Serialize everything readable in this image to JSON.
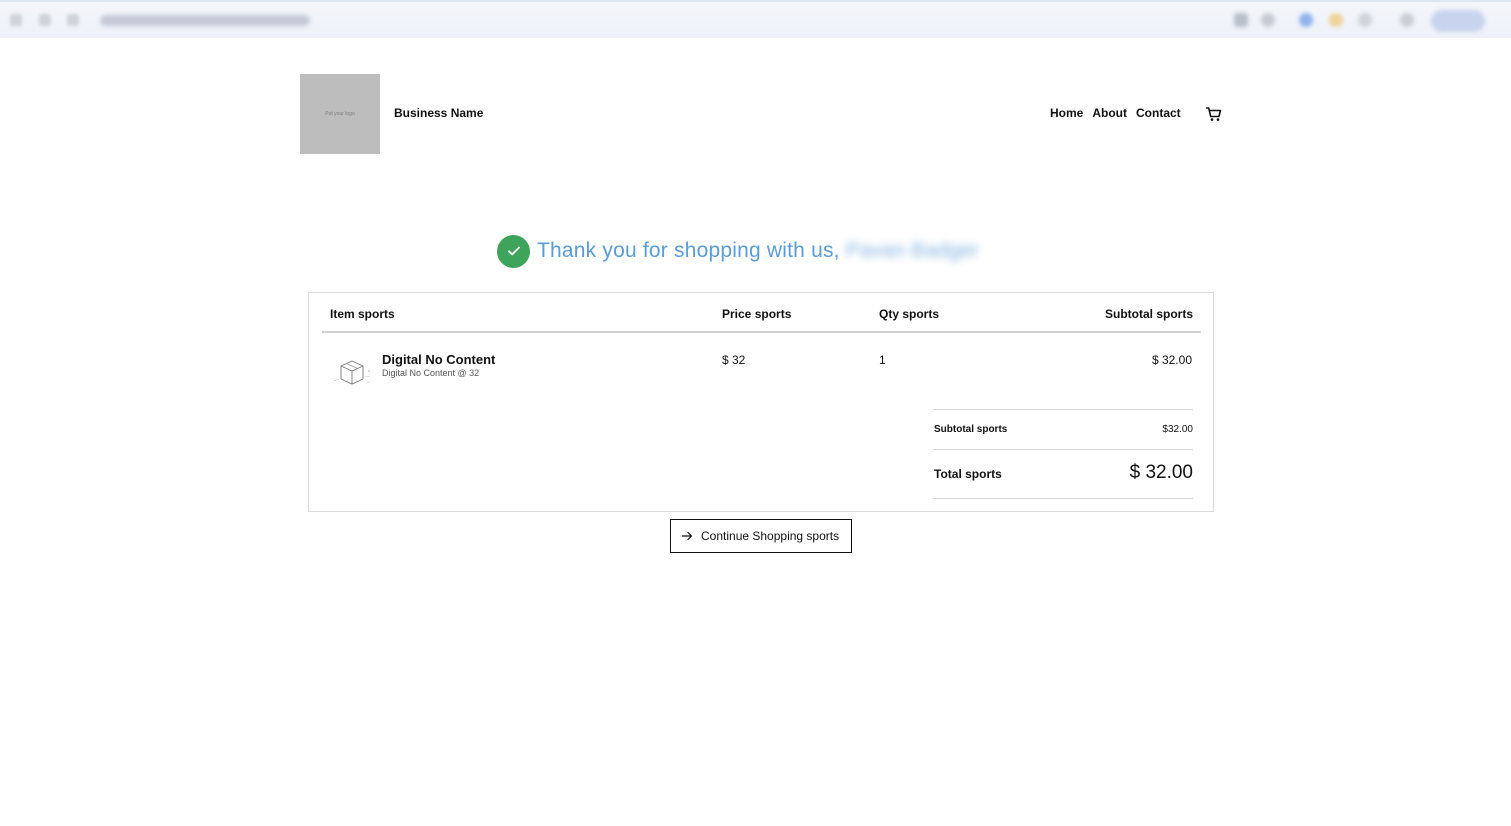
{
  "header": {
    "logo_placeholder": "Put your logo",
    "business_name": "Business Name",
    "nav": [
      "Home",
      "About",
      "Contact"
    ]
  },
  "confirmation": {
    "message": "Thank you for shopping with us,",
    "customer_name": "Pavan Badger"
  },
  "order_table": {
    "columns": [
      "Item sports",
      "Price sports",
      "Qty sports",
      "Subtotal sports"
    ],
    "items": [
      {
        "name": "Digital No Content",
        "detail": "Digital No Content @ 32",
        "price": "$ 32",
        "qty": "1",
        "subtotal": "$ 32.00"
      }
    ],
    "subtotal_label": "Subtotal sports",
    "subtotal_value": "$32.00",
    "total_label": "Total sports",
    "total_value": "$ 32.00"
  },
  "actions": {
    "continue_label": "Continue Shopping sports"
  },
  "colors": {
    "accent_text": "#5b9bd6",
    "success": "#3fa45b"
  },
  "icons": [
    "cart-icon",
    "check-circle-icon",
    "package-box-icon",
    "arrow-right-icon"
  ]
}
